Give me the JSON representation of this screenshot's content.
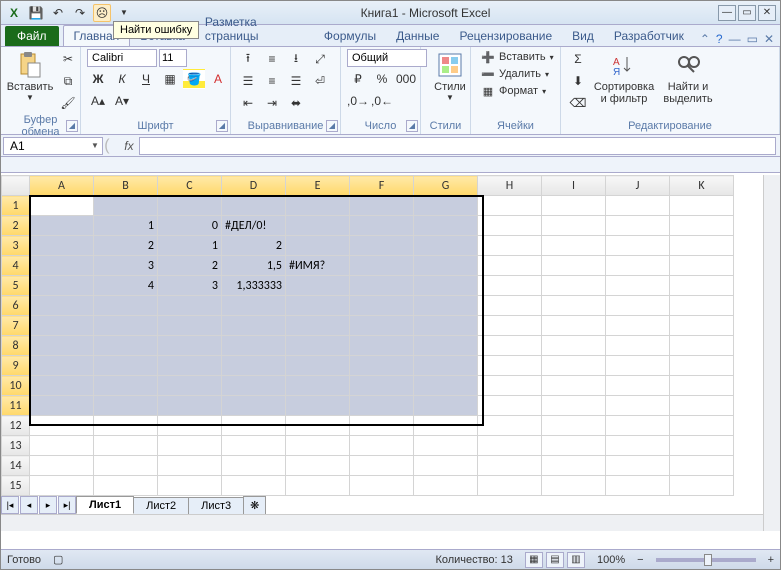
{
  "title": "Книга1  -  Microsoft Excel",
  "qat": {
    "save": "💾",
    "undo": "↶",
    "redo": "↷",
    "smiley": "☹"
  },
  "tooltip": "Найти ошибку",
  "tabs": {
    "file": "Файл",
    "home": "Главная",
    "insert": "Вставка",
    "layout": "Разметка страницы",
    "formulas": "Формулы",
    "data": "Данные",
    "review": "Рецензирование",
    "view": "Вид",
    "developer": "Разработчик"
  },
  "ribbon": {
    "clipboard": {
      "label": "Буфер обмена",
      "paste": "Вставить"
    },
    "font": {
      "label": "Шрифт",
      "name": "Calibri",
      "size": "11"
    },
    "alignment": {
      "label": "Выравнивание"
    },
    "number": {
      "label": "Число",
      "format": "Общий"
    },
    "styles": {
      "label": "Стили",
      "btn": "Стили"
    },
    "cells": {
      "label": "Ячейки",
      "insert": "Вставить",
      "delete": "Удалить",
      "format": "Формат"
    },
    "editing": {
      "label": "Редактирование",
      "sort": "Сортировка и фильтр",
      "find": "Найти и выделить"
    }
  },
  "namebox": "A1",
  "formula": "",
  "columns": [
    "A",
    "B",
    "C",
    "D",
    "E",
    "F",
    "G",
    "H",
    "I",
    "J",
    "K"
  ],
  "rows": [
    "1",
    "2",
    "3",
    "4",
    "5",
    "6",
    "7",
    "8",
    "9",
    "10",
    "11",
    "12",
    "13",
    "14",
    "15"
  ],
  "cells": {
    "B2": "1",
    "B3": "2",
    "B4": "3",
    "B5": "4",
    "C2": "0",
    "C3": "1",
    "C4": "2",
    "C5": "3",
    "D2": "#ДЕЛ/0!",
    "D3": "2",
    "D4": "1,5",
    "D5": "1,333333",
    "E4": "#ИМЯ?"
  },
  "selection": {
    "from": "A1",
    "to": "G11",
    "active": "A1"
  },
  "sheets": {
    "s1": "Лист1",
    "s2": "Лист2",
    "s3": "Лист3"
  },
  "status": {
    "ready": "Готово",
    "count": "Количество: 13",
    "zoom": "100%"
  }
}
